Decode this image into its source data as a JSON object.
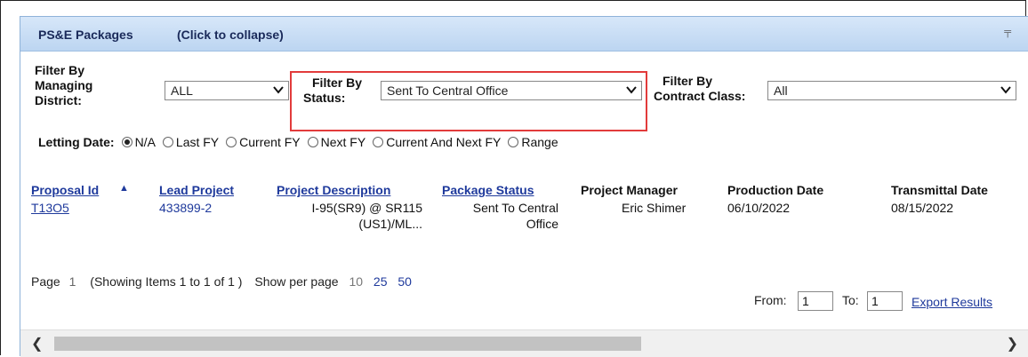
{
  "header": {
    "title": "PS&E Packages",
    "collapse_label": "(Click to collapse)",
    "pin_icon": "pin-icon"
  },
  "filters": {
    "district": {
      "label_l1": "Filter By",
      "label_l2": "Managing",
      "label_l3": "District:",
      "value": "ALL"
    },
    "status": {
      "label_l1": "Filter By",
      "label_l2": "Status:",
      "value": "Sent To Central Office"
    },
    "contract": {
      "label_l1": "Filter By",
      "label_l2": "Contract Class:",
      "value": "All"
    }
  },
  "letting": {
    "label": "Letting Date:",
    "options": [
      "N/A",
      "Last FY",
      "Current FY",
      "Next FY",
      "Current And Next FY",
      "Range"
    ],
    "selected": "N/A"
  },
  "table": {
    "columns": [
      "Proposal Id",
      "Lead Project",
      "Project Description",
      "Package Status",
      "Project Manager",
      "Production Date",
      "Transmittal Date"
    ],
    "sort_indicator": "▲",
    "row": {
      "proposal_id": "T13O5",
      "lead_project": "433899-2",
      "desc_l1": "I-95(SR9) @ SR115",
      "desc_l2": "(US1)/ML...",
      "status_l1": "Sent To Central",
      "status_l2": "Office",
      "manager": "Eric Shimer",
      "production_date": "06/10/2022",
      "transmittal_date": "08/15/2022"
    }
  },
  "pager": {
    "page_label": "Page",
    "page_num": "1",
    "showing": "(Showing Items 1 to 1 of 1 )",
    "per_page_label": "Show per page",
    "sizes": [
      "10",
      "25",
      "50"
    ]
  },
  "export": {
    "from_label": "From:",
    "from_value": "1",
    "to_label": "To:",
    "to_value": "1",
    "export_label": "Export Results"
  },
  "colors": {
    "header_bg": "#c9ddf5",
    "link": "#1f3a9c",
    "highlight": "#e23b3b"
  }
}
